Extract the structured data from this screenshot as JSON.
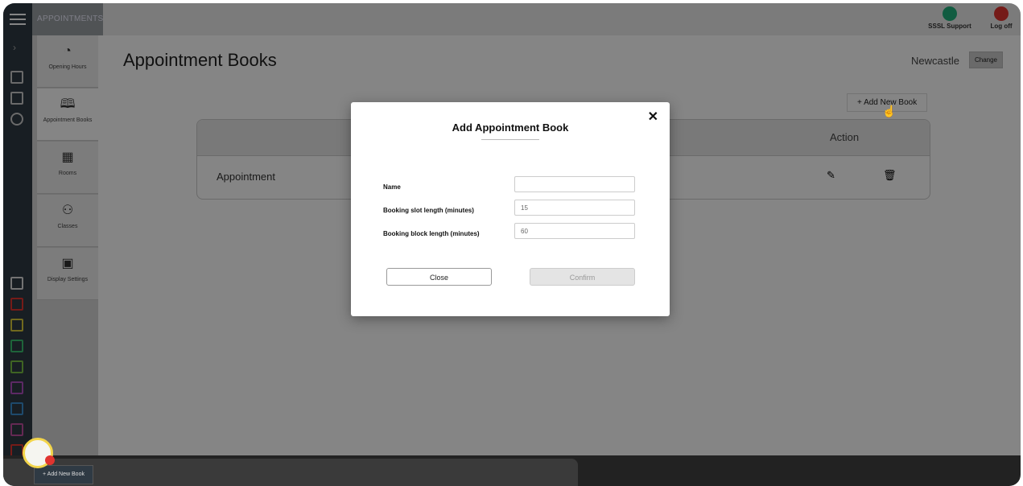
{
  "app": {
    "name": "APPOINTMENTS"
  },
  "top_actions": [
    {
      "label": "SSSL Support",
      "color": "#22b07d",
      "icon": "support-icon"
    },
    {
      "label": "Log off",
      "color": "#e0342f",
      "icon": "power-icon"
    }
  ],
  "submenu": [
    {
      "label": "Opening Hours",
      "icon": "clock-icon"
    },
    {
      "label": "Appointment Books",
      "icon": "book-icon",
      "active": true
    },
    {
      "label": "Rooms",
      "icon": "rooms-icon"
    },
    {
      "label": "Classes",
      "icon": "classes-icon"
    },
    {
      "label": "Display Settings",
      "icon": "display-icon"
    }
  ],
  "page": {
    "title": "Appointment Books",
    "location": "Newcastle",
    "change_label": "Change",
    "add_new_book_label": "+ Add New Book"
  },
  "table": {
    "action_header": "Action",
    "rows": [
      {
        "name": "Appointment"
      }
    ]
  },
  "modal": {
    "title": "Add Appointment Book",
    "fields": [
      {
        "label": "Name",
        "value": ""
      },
      {
        "label": "Booking slot length (minutes)",
        "value": "15"
      },
      {
        "label": "Booking block length (minutes)",
        "value": "60"
      }
    ],
    "close_label": "Close",
    "confirm_label": "Confirm"
  },
  "bottom": {
    "add_new_book_label": "+ Add New Book"
  }
}
